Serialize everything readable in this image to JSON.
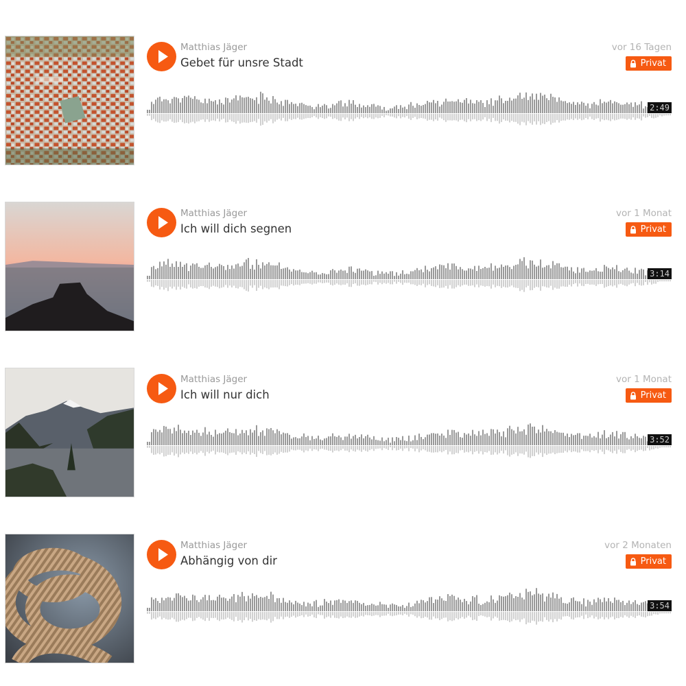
{
  "colors": {
    "accent": "#f65a12",
    "wave_top": "#999999",
    "wave_bottom": "#d0d0d0",
    "text_dark": "#333333",
    "text_muted": "#999999"
  },
  "tracks": [
    {
      "artist": "Matthias Jäger",
      "title": "Gebet für unsre Stadt",
      "date": "vor 16 Tagen",
      "privacy": "Privat",
      "duration": "2:49",
      "cover_icon": "aerial-town-photo",
      "progress": 0
    },
    {
      "artist": "Matthias Jäger",
      "title": "Ich will dich segnen",
      "date": "vor 1 Monat",
      "privacy": "Privat",
      "duration": "3:14",
      "cover_icon": "sunset-cliff-sea-photo",
      "progress": 0
    },
    {
      "artist": "Matthias Jäger",
      "title": "Ich will nur dich",
      "date": "vor 1 Monat",
      "privacy": "Privat",
      "duration": "3:52",
      "cover_icon": "mountain-lake-photo",
      "progress": 0
    },
    {
      "artist": "Matthias Jäger",
      "title": "Abhängig von dir",
      "date": "vor 2 Monaten",
      "privacy": "Privat",
      "duration": "3:54",
      "cover_icon": "coiled-rope-photo",
      "progress": 0
    }
  ]
}
